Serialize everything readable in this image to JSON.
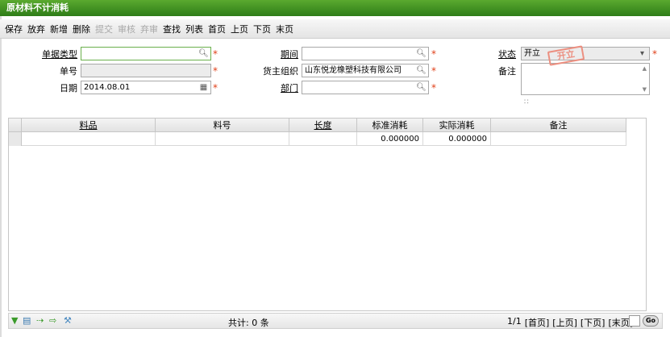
{
  "window": {
    "title": "原材料不计消耗"
  },
  "toolbar": {
    "items": [
      {
        "label": "保存",
        "enabled": true
      },
      {
        "label": "放弃",
        "enabled": true
      },
      {
        "label": "新增",
        "enabled": true
      },
      {
        "label": "删除",
        "enabled": true
      },
      {
        "label": "提交",
        "enabled": false
      },
      {
        "label": "审核",
        "enabled": false
      },
      {
        "label": "弃审",
        "enabled": false
      },
      {
        "label": "查找",
        "enabled": true
      },
      {
        "label": "列表",
        "enabled": true
      },
      {
        "label": "首页",
        "enabled": true
      },
      {
        "label": "上页",
        "enabled": true
      },
      {
        "label": "下页",
        "enabled": true
      },
      {
        "label": "末页",
        "enabled": true
      }
    ]
  },
  "form": {
    "doc_type": {
      "label": "单据类型",
      "value": ""
    },
    "doc_no": {
      "label": "单号",
      "value": ""
    },
    "date": {
      "label": "日期",
      "value": "2014.08.01"
    },
    "period": {
      "label": "期间",
      "value": ""
    },
    "owner_org": {
      "label": "货主组织",
      "value": "山东悦龙橡塑科技有限公司"
    },
    "department": {
      "label": "部门",
      "value": ""
    },
    "status": {
      "label": "状态",
      "value": "开立"
    },
    "remark": {
      "label": "备注",
      "value": ""
    },
    "stamp": "开立",
    "required_mark": "*"
  },
  "grid": {
    "columns": [
      {
        "label": "料品",
        "link": true
      },
      {
        "label": "料号",
        "link": false
      },
      {
        "label": "长度",
        "link": true
      },
      {
        "label": "标准消耗",
        "link": false
      },
      {
        "label": "实际消耗",
        "link": false
      },
      {
        "label": "备注",
        "link": false
      }
    ],
    "rows": [
      {
        "item": "",
        "code": "",
        "length": "",
        "std": "0.000000",
        "actual": "0.000000",
        "remark": ""
      }
    ]
  },
  "footer": {
    "total": "共计: 0 条",
    "page": "1/1",
    "first": "[首页]",
    "prev": "[上页]",
    "next": "[下页]",
    "last": "[末页]",
    "go": "Go"
  },
  "colors": {
    "title_bar": "#3a8c1f",
    "required": "#e0401a",
    "stamp": "#ec8f80"
  }
}
